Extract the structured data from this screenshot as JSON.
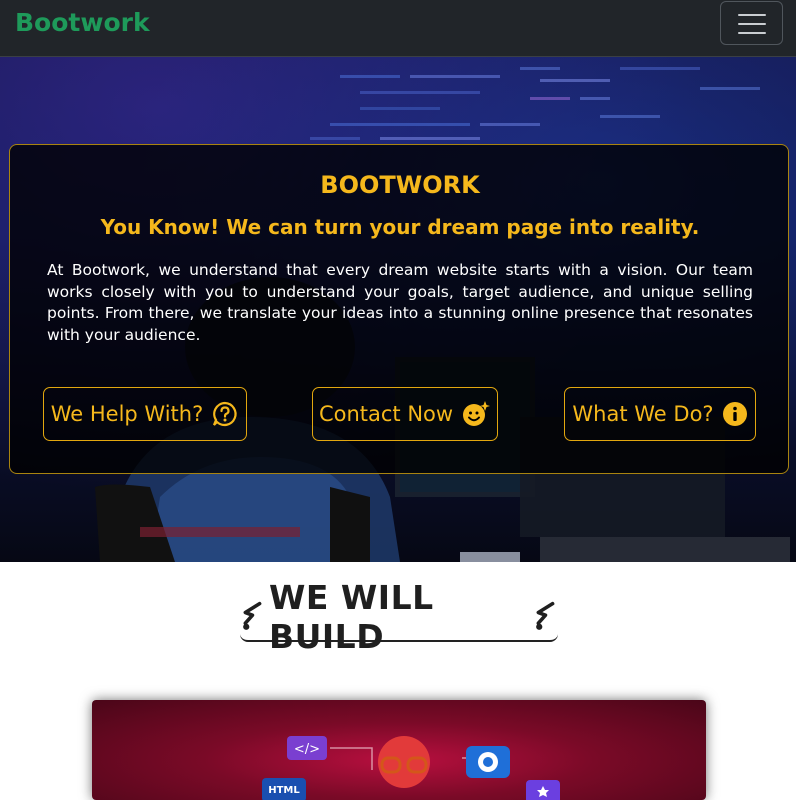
{
  "navbar": {
    "brand": "Bootwork",
    "toggle_icon": "hamburger-menu-icon"
  },
  "hero": {
    "title": "BOOTWORK",
    "subtitle": "You Know! We can turn your dream page into reality.",
    "description": "At Bootwork, we understand that every dream website starts with a vision. Our team works closely with you to understand your goals, target audience, and unique selling points. From there, we translate your ideas into a stunning online presence that resonates with your audience.",
    "buttons": [
      {
        "label": "We Help With?",
        "icon": "question-chat-icon"
      },
      {
        "label": "Contact Now",
        "icon": "smile-sparkle-icon"
      },
      {
        "label": "What We Do?",
        "icon": "info-circle-icon"
      }
    ],
    "accent_color": "#f5b81c"
  },
  "section": {
    "title": "WE WILL BUILD",
    "title_icon": "lightning-icon"
  },
  "preview_image": {
    "labels": [
      "</>",
      "HTML"
    ]
  }
}
